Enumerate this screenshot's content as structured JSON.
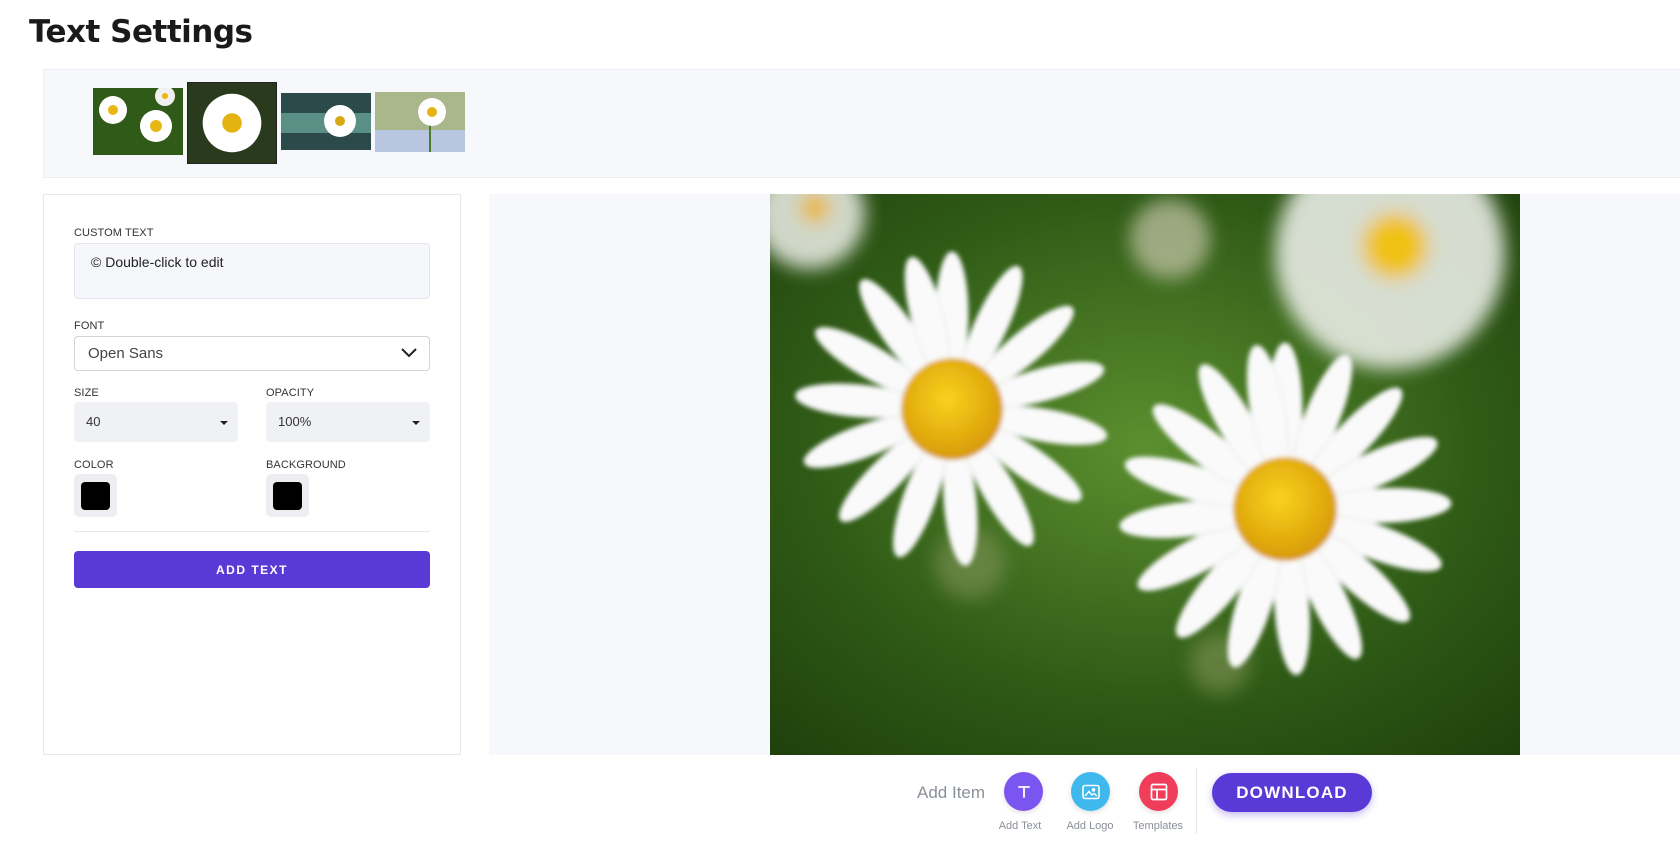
{
  "page": {
    "title": "Text Settings"
  },
  "thumbnails": [
    {
      "name": "daisy-thumb-1",
      "selected": false
    },
    {
      "name": "daisy-thumb-2",
      "selected": true
    },
    {
      "name": "daisy-thumb-3",
      "selected": false
    },
    {
      "name": "daisy-thumb-4",
      "selected": false
    }
  ],
  "settings": {
    "custom_text_label": "CUSTOM TEXT",
    "custom_text_value": "© Double-click to edit",
    "font_label": "FONT",
    "font_value": "Open Sans",
    "size_label": "SIZE",
    "size_value": "40",
    "opacity_label": "OPACITY",
    "opacity_value": "100%",
    "color_label": "COLOR",
    "color_value": "#000000",
    "background_label": "BACKGROUND",
    "background_value": "#000000",
    "add_text_label": "ADD TEXT"
  },
  "toolbar": {
    "add_item_label": "Add Item",
    "add_text_caption": "Add Text",
    "add_logo_caption": "Add Logo",
    "templates_caption": "Templates",
    "download_label": "DOWNLOAD",
    "add_text_icon": "text-t-icon",
    "add_logo_icon": "image-icon",
    "templates_icon": "layout-icon"
  },
  "colors": {
    "accent": "#5a3ad6",
    "add_text_bg": "#7b55f0",
    "add_logo_bg": "#3fb8ee",
    "templates_bg": "#ef3d5a"
  }
}
